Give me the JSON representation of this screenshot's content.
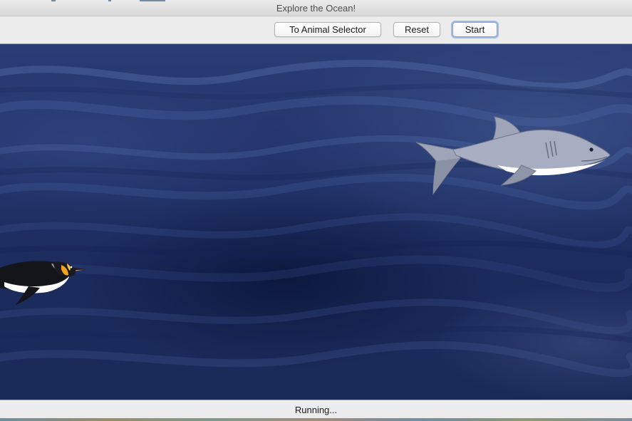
{
  "window": {
    "title": "Explore the Ocean!"
  },
  "toolbar": {
    "animal_selector_label": "To Animal Selector",
    "reset_label": "Reset",
    "start_label": "Start"
  },
  "scene": {
    "animals": [
      "shark",
      "penguin"
    ]
  },
  "status": {
    "text": "Running..."
  }
}
